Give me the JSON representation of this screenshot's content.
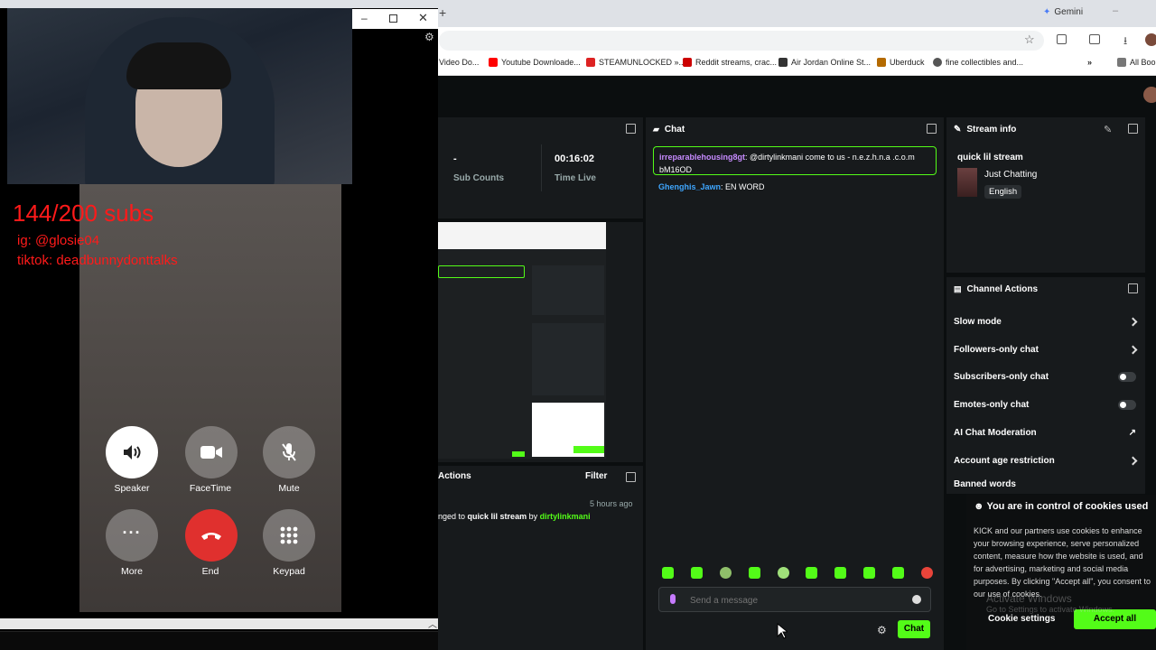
{
  "browser": {
    "gemini_label": "Gemini",
    "bookmarks": [
      {
        "label": "Video Do...",
        "color": "#888888"
      },
      {
        "label": "Youtube Downloade...",
        "color": "#ff0000"
      },
      {
        "label": "STEAMUNLOCKED »...",
        "color": "#d22"
      },
      {
        "label": "Reddit streams, crac...",
        "color": "#c00"
      },
      {
        "label": "Air Jordan Online St...",
        "color": "#333333"
      },
      {
        "label": "Uberduck",
        "color": "#b46a00"
      },
      {
        "label": "fine collectibles and...",
        "color": "#555555"
      },
      {
        "label": "All Boo",
        "color": "#777777"
      }
    ]
  },
  "facetime": {
    "overlay_subs": "144/200 subs",
    "overlay_ig": "ig: @glosie04",
    "overlay_tiktok": "tiktok: deadbunnydonttalks",
    "buttons": [
      {
        "label": "Speaker",
        "icon": "speaker-icon"
      },
      {
        "label": "FaceTime",
        "icon": "video-camera-icon"
      },
      {
        "label": "Mute",
        "icon": "mic-muted-icon"
      },
      {
        "label": "More",
        "icon": "more-icon"
      },
      {
        "label": "End",
        "icon": "end-call-icon"
      },
      {
        "label": "Keypad",
        "icon": "keypad-icon"
      }
    ]
  },
  "stats": {
    "sub_value": "-",
    "sub_label": "Sub Counts",
    "time_value": "00:16:02",
    "time_label": "Time Live"
  },
  "actions": {
    "title": "Actions",
    "filter_label": "Filter",
    "item_time": "5 hours ago",
    "item_prefix": "nged to",
    "item_title": "quick lil stream",
    "item_by": "by",
    "item_user": "dirtylinkmani"
  },
  "chat": {
    "title": "Chat",
    "messages": [
      {
        "user": "irreparablehousing8gt",
        "text": ": @dirtylinkmani come to us - n.e.z.h.n.a .c.o.m bM16OD",
        "user_color": "#c78bff"
      },
      {
        "user": "Ghenghis_Jawn",
        "text": ": EN WORD",
        "user_color": "#3fa7ff"
      }
    ],
    "placeholder": "Send a message",
    "send_label": "Chat"
  },
  "stream_info": {
    "title": "Stream info",
    "stream_title": "quick lil stream",
    "category": "Just Chatting",
    "language": "English"
  },
  "channel_actions": {
    "title": "Channel Actions",
    "items": [
      {
        "label": "Slow mode",
        "control": "chevron"
      },
      {
        "label": "Followers-only chat",
        "control": "chevron"
      },
      {
        "label": "Subscribers-only chat",
        "control": "toggle"
      },
      {
        "label": "Emotes-only chat",
        "control": "toggle"
      },
      {
        "label": "AI Chat Moderation",
        "control": "external"
      },
      {
        "label": "Account age restriction",
        "control": "chevron"
      },
      {
        "label": "Banned words",
        "control": "chevron"
      }
    ]
  },
  "cookie": {
    "title": "You are in control of cookies used",
    "body": "KICK and our partners use cookies to enhance your browsing experience, serve personalized content, measure how the website is used, and for advertising, marketing and social media purposes. By clicking \"Accept all\", you consent to our use of cookies.",
    "settings_label": "Cookie settings",
    "accept_label": "Accept all"
  },
  "watermark": {
    "line1": "Activate Windows",
    "line2": "Go to Settings to activate Windows."
  },
  "colors": {
    "kick_green": "#53fc18",
    "end_red": "#e0302e",
    "overlay_red": "#ff1a1a"
  }
}
